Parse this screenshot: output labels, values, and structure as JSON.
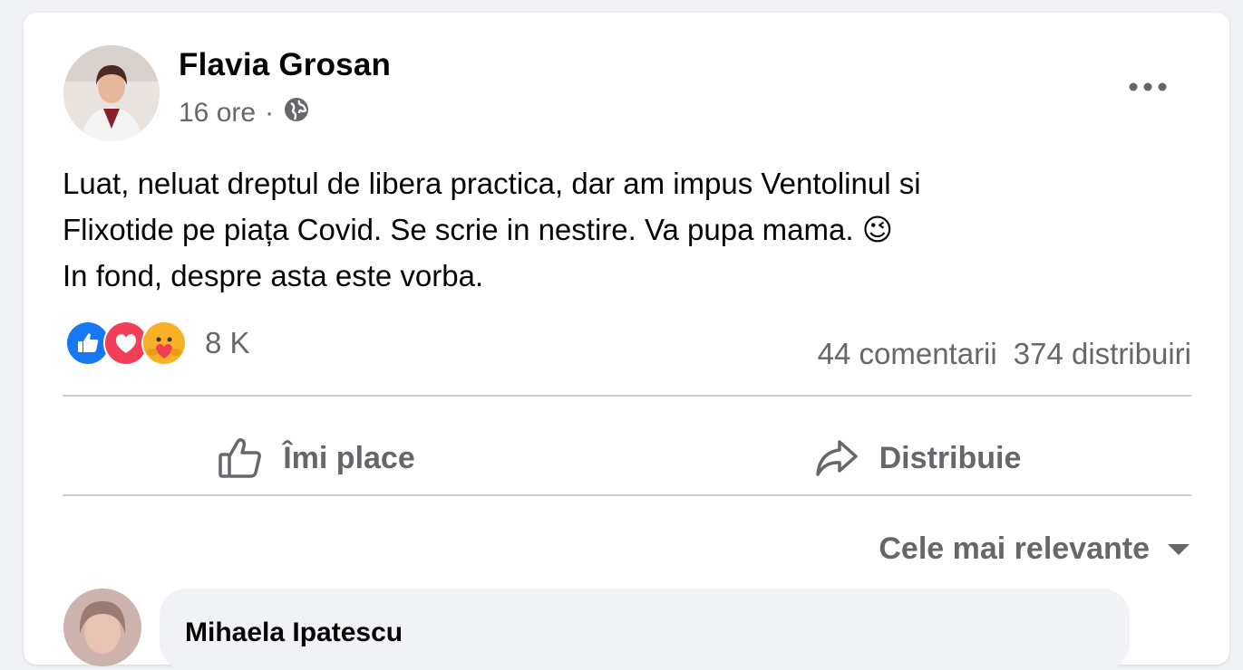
{
  "post": {
    "author": "Flavia Grosan",
    "time": "16 ore",
    "separator": "·",
    "privacy_icon": "globe-icon",
    "more_icon": "more-horizontal-icon",
    "text_lines": [
      "Luat, neluat dreptul de libera practica, dar am impus Ventolinul si",
      "Flixotide  pe piața Covid. Se scrie in nestire. Va pupa mama. 😉",
      "In fond, despre asta este vorba."
    ]
  },
  "reactions": {
    "icons": [
      "like-reaction-icon",
      "love-reaction-icon",
      "care-reaction-icon"
    ],
    "count": "8 K"
  },
  "stats": {
    "comments": "44 comentarii",
    "shares": "374 distribuiri"
  },
  "actions": {
    "like_label": "Îmi place",
    "share_label": "Distribuie"
  },
  "comments": {
    "sort_label": "Cele mai relevante",
    "first_comment_author": "Mihaela Ipatescu"
  },
  "colors": {
    "background": "#f0f2f5",
    "card": "#ffffff",
    "text_primary": "#050505",
    "text_secondary": "#65676b",
    "like_blue": "#1877f2",
    "love_red": "#f33e58"
  }
}
